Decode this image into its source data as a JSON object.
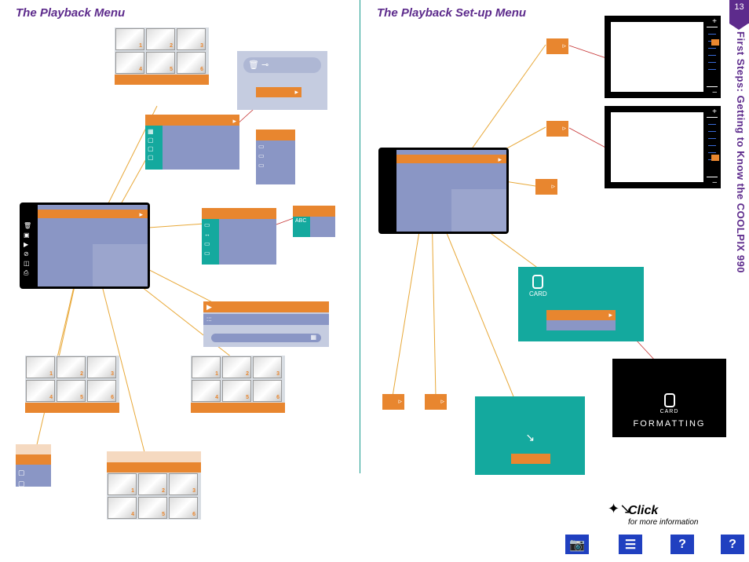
{
  "titles": {
    "left": "The Playback Menu",
    "right": "The Playback Set-up Menu"
  },
  "page_number": "13",
  "side_text": "First Steps: Getting to Know the COOLPIX 990",
  "click": {
    "title": "Click",
    "subtitle": "for more information"
  },
  "card": {
    "label": "CARD",
    "formatting": "FORMATTING"
  },
  "brightness": {
    "plus": "+",
    "minus": "–"
  },
  "thumbs": [
    "1",
    "2",
    "3",
    "4",
    "5",
    "6"
  ],
  "nav": {
    "camera": "📷",
    "list": "☰",
    "q1": "?",
    "q2": "?"
  }
}
